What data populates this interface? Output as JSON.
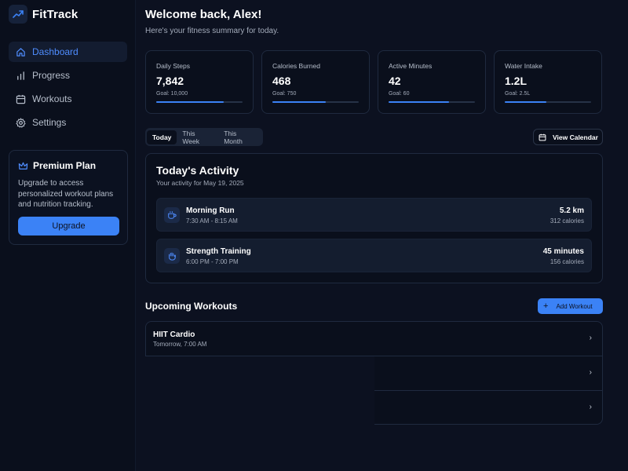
{
  "app": {
    "name": "FitTrack",
    "logo_icon": "trending-up-icon"
  },
  "colors": {
    "accent": "#3b82f6",
    "background": "#0c1120",
    "panel": "#0a0f1c"
  },
  "sidebar": {
    "items": [
      {
        "label": "Dashboard",
        "icon": "home-icon",
        "active": true
      },
      {
        "label": "Progress",
        "icon": "bar-chart-icon",
        "active": false
      },
      {
        "label": "Workouts",
        "icon": "calendar-icon",
        "active": false
      },
      {
        "label": "Settings",
        "icon": "gear-icon",
        "active": false
      }
    ],
    "premium": {
      "title": "Premium Plan",
      "description": "Upgrade to access personalized workout plans and nutrition tracking.",
      "button": "Upgrade"
    }
  },
  "header": {
    "title": "Welcome back, Alex!",
    "subtitle": "Here's your fitness summary for today."
  },
  "stats": [
    {
      "label": "Daily Steps",
      "value": "7,842",
      "goal": "Goal: 10,000",
      "progress": 0.78
    },
    {
      "label": "Calories Burned",
      "value": "468",
      "goal": "Goal: 750",
      "progress": 0.62
    },
    {
      "label": "Active Minutes",
      "value": "42",
      "goal": "Goal: 60",
      "progress": 0.7
    },
    {
      "label": "Water Intake",
      "value": "1.2L",
      "goal": "Goal: 2.5L",
      "progress": 0.48
    }
  ],
  "tabs": [
    {
      "label": "Today",
      "active": true
    },
    {
      "label": "This Week",
      "active": false
    },
    {
      "label": "This Month",
      "active": false
    }
  ],
  "view_calendar": "View Calendar",
  "activity": {
    "title": "Today's Activity",
    "subtitle": "Your activity for May 19, 2025",
    "items": [
      {
        "name": "Morning Run",
        "time": "7:30 AM - 8:15 AM",
        "amount": "5.2 km",
        "calories": "312 calories",
        "icon": "coffee-icon"
      },
      {
        "name": "Strength Training",
        "time": "6:00 PM - 7:00 PM",
        "amount": "45 minutes",
        "calories": "156 calories",
        "icon": "hand-icon"
      }
    ]
  },
  "upcoming": {
    "title": "Upcoming Workouts",
    "add_button": "Add Workout",
    "items": [
      {
        "name": "HIIT Cardio",
        "time": "Tomorrow, 7:00 AM"
      },
      {
        "name": "",
        "time": ""
      },
      {
        "name": "",
        "time": ""
      }
    ]
  }
}
